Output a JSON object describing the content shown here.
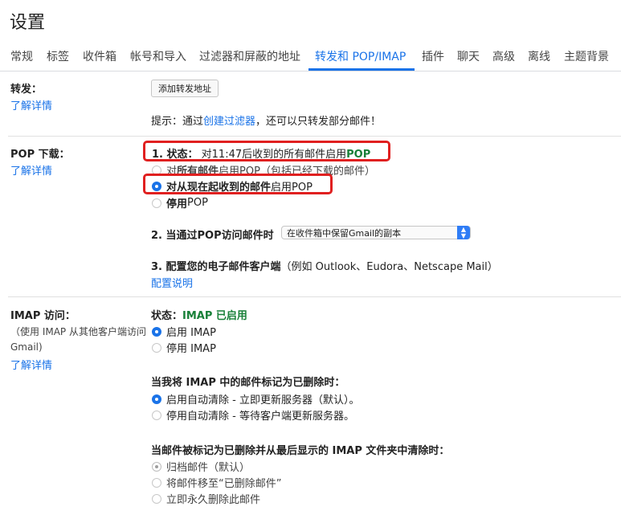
{
  "page_title": "设置",
  "tabs": [
    "常规",
    "标签",
    "收件箱",
    "帐号和导入",
    "过滤器和屏蔽的地址",
    "转发和 POP/IMAP",
    "插件",
    "聊天",
    "高级",
    "离线",
    "主题背景"
  ],
  "forwarding": {
    "label": "转发：",
    "learn_more": "了解详情",
    "add_button": "添加转发地址",
    "tip_prefix": "提示：通过",
    "tip_link": "创建过滤器",
    "tip_suffix": "，还可以只转发部分邮件！"
  },
  "pop": {
    "label": "POP 下载：",
    "learn_more": "了解详情",
    "status_label": "1. 状态：",
    "status_text": "对11:47后收到的所有邮件启用",
    "status_value": "POP",
    "option_all_prefix": "对",
    "option_all_bold": "所有邮件",
    "option_all_suffix": "启用POP（包括已经下载的邮件）",
    "option_now_bold": "对从现在起收到的邮件",
    "option_now_suffix": "启用POP",
    "option_disable_bold": "停用",
    "option_disable_suffix": "POP",
    "when_access_label": "2. 当通过POP访问邮件时",
    "when_access_select": "在收件箱中保留Gmail的副本",
    "configure_label": "3. 配置您的电子邮件客户端",
    "configure_examples": "（例如 Outlook、Eudora、Netscape Mail）",
    "config_link": "配置说明"
  },
  "imap": {
    "label": "IMAP 访问：",
    "sub_line1": "（使用 IMAP 从其他客户端访问",
    "sub_line2": "Gmail)",
    "learn_more": "了解详情",
    "status_label": "状态：",
    "status_value": "IMAP 已启用",
    "enable": "启用 IMAP",
    "disable": "停用 IMAP",
    "deleted_heading": "当我将 IMAP 中的邮件标记为已删除时：",
    "auto_expunge_on": "启用自动清除 - 立即更新服务器（默认）。",
    "auto_expunge_off": "停用自动清除 - 等待客户端更新服务器。",
    "expunge_heading": "当邮件被标记为已删除并从最后显示的 IMAP 文件夹中清除时：",
    "archive": "归档邮件（默认）",
    "move_trash": "将邮件移至“已删除邮件”",
    "delete_forever": "立即永久删除此邮件"
  },
  "colors": {
    "accent": "#1a73e8",
    "status_green": "#188038",
    "highlight_red": "#e02020"
  }
}
